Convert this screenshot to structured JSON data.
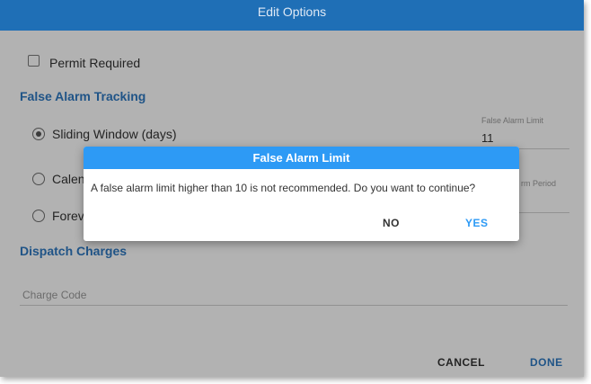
{
  "window": {
    "title": "Edit Options"
  },
  "permit": {
    "label": "Permit Required",
    "checked": false
  },
  "false_alarm_tracking": {
    "heading": "False Alarm Tracking",
    "options": [
      {
        "label": "Sliding Window (days)",
        "selected": true
      },
      {
        "label": "Calen",
        "selected": false
      },
      {
        "label": "Forev",
        "selected": false
      }
    ],
    "limit_field": {
      "label": "False Alarm Limit",
      "value": "11"
    },
    "period_field": {
      "label": "rm Period"
    }
  },
  "dispatch_charges": {
    "heading": "Dispatch Charges",
    "charge_code_placeholder": "Charge Code"
  },
  "footer": {
    "cancel_label": "CANCEL",
    "done_label": "DONE"
  },
  "dialog": {
    "title": "False Alarm Limit",
    "message": "A false alarm limit higher than 10 is not recommended. Do you want to continue?",
    "no_label": "NO",
    "yes_label": "YES"
  },
  "colors": {
    "titlebar": "#1f6fb6",
    "accent": "#2e79c2",
    "dialog_header": "#2d9af5"
  }
}
